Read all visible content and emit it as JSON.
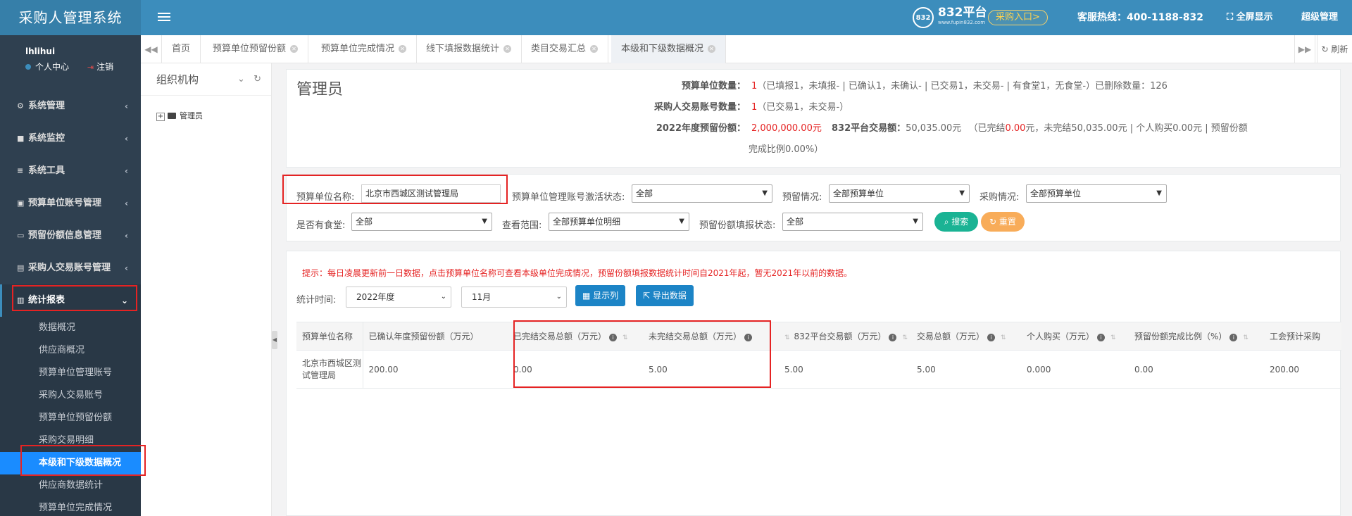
{
  "app": {
    "title": "采购人管理系统",
    "logo_text": "832平台",
    "logo_site": "www.fupin832.com",
    "entry_button": "采购入口>",
    "hotline": "客服热线：400-1188-832",
    "fullscreen": "全屏显示",
    "admin": "超级管理",
    "accent_color": "#3c8dbc"
  },
  "user": {
    "name": "lhlihui",
    "center": "个人中心",
    "logout": "注销"
  },
  "sidebar": {
    "items": [
      {
        "label": "系统管理",
        "icon": "gear-icon"
      },
      {
        "label": "系统监控",
        "icon": "video-icon"
      },
      {
        "label": "系统工具",
        "icon": "list-icon"
      },
      {
        "label": "预算单位账号管理",
        "icon": "building-icon"
      },
      {
        "label": "预留份额信息管理",
        "icon": "card-icon"
      },
      {
        "label": "采购人交易账号管理",
        "icon": "contact-icon"
      },
      {
        "label": "统计报表",
        "icon": "chart-icon"
      }
    ],
    "sub_items": [
      "数据概况",
      "供应商概况",
      "预算单位管理账号",
      "采购人交易账号",
      "预算单位预留份额",
      "采购交易明细",
      "本级和下级数据概况",
      "供应商数据统计",
      "预算单位完成情况"
    ]
  },
  "tabs": {
    "items": [
      "首页",
      "预算单位预留份额",
      "预算单位完成情况",
      "线下填报数据统计",
      "类目交易汇总",
      "本级和下级数据概况"
    ],
    "refresh": "刷新"
  },
  "org": {
    "title": "组织机构",
    "root_node": "管理员"
  },
  "summary": {
    "title": "管理员",
    "rows": [
      {
        "label": "预算单位数量：",
        "value": "1",
        "detail": "（已填报1，未填报- | 已确认1，未确认- | 已交易1，未交易- | 有食堂1，无食堂-）已删除数量：126"
      },
      {
        "label": "采购人交易账号数量：",
        "value": "1",
        "detail": "（已交易1，未交易-）"
      }
    ],
    "amount_label": "2022年度预留份额：",
    "amount_value": "2,000,000.00元",
    "platform_label": "832平台交易额：",
    "platform_value": "50,035.00元",
    "platform_detail_pre": "（已完结",
    "platform_done": "0.00",
    "platform_detail_post": "元，未完结50,035.00元 | 个人购买0.00元 | 预留份额",
    "ratio_line": "完成比例0.00%）"
  },
  "filters": {
    "unit_name_label": "预算单位名称:",
    "unit_name_value": "北京市西城区测试管理局",
    "activation_label": "预算单位管理账号激活状态:",
    "activation_value": "全部",
    "reserve_label": "预留情况:",
    "reserve_value": "全部预算单位",
    "purchase_label": "采购情况:",
    "purchase_value": "全部预算单位",
    "canteen_label": "是否有食堂:",
    "canteen_value": "全部",
    "scope_label": "查看范围:",
    "scope_value": "全部预算单位明细",
    "fill_label": "预留份额填报状态:",
    "fill_value": "全部",
    "search_btn": "搜索",
    "reset_btn": "重置"
  },
  "data": {
    "tip": "提示：每日凌晨更新前一日数据，点击预算单位名称可查看本级单位完成情况，预留份额填报数据统计时间自2021年起，暂无2021年以前的数据。",
    "period_label": "统计时间:",
    "year_value": "2022年度",
    "month_value": "11月",
    "show_btn": "显示列",
    "export_btn": "导出数据",
    "columns": [
      "预算单位名称",
      "已确认年度预留份额（万元）",
      "已完结交易总额（万元）",
      "未完结交易总额（万元）",
      "832平台交易额（万元）",
      "交易总额（万元）",
      "个人购买（万元）",
      "预留份额完成比例（%）",
      "工会预计采购"
    ],
    "rows": [
      [
        "北京市西城区测试管理局",
        "200.00",
        "0.00",
        "5.00",
        "5.00",
        "5.00",
        "0.000",
        "0.00",
        "200.00"
      ]
    ]
  }
}
